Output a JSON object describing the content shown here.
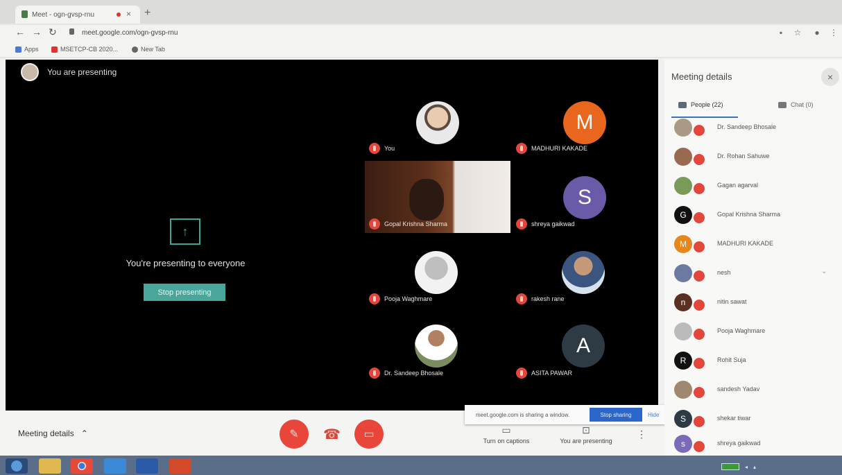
{
  "browser": {
    "tab_title": "Meet - ogn-gvsp-rnu",
    "url": "meet.google.com/ogn-gvsp-rnu",
    "bookmarks": [
      {
        "label": "Apps",
        "icon": "apps-icon"
      },
      {
        "label": "MSETCP-CB 2020...",
        "icon": "bookmark-icon"
      },
      {
        "label": "New Tab",
        "icon": "globe-icon"
      }
    ]
  },
  "meet": {
    "presenting_label": "You are presenting",
    "presenting_message": "You're presenting to everyone",
    "stop_presenting_label": "Stop presenting",
    "tiles": [
      {
        "name": "You",
        "avatar_letter": "",
        "avatar_color": "#d8d8d8",
        "style": "photo"
      },
      {
        "name": "MADHURI KAKADE",
        "avatar_letter": "M",
        "avatar_color": "#e8661e",
        "style": "letter"
      },
      {
        "name": "Gopal Krishna Sharma",
        "avatar_letter": "",
        "avatar_color": "#000000",
        "style": "video"
      },
      {
        "name": "shreya gaikwad",
        "avatar_letter": "S",
        "avatar_color": "#6a5aa8",
        "style": "letter"
      },
      {
        "name": "Pooja Waghmare",
        "avatar_letter": "",
        "avatar_color": "#cccccc",
        "style": "photo2"
      },
      {
        "name": "rakesh rane",
        "avatar_letter": "",
        "avatar_color": "#cccccc",
        "style": "photo3"
      },
      {
        "name": "Dr. Sandeep Bhosale",
        "avatar_letter": "",
        "avatar_color": "#cccccc",
        "style": "photo4"
      },
      {
        "name": "ASITA PAWAR",
        "avatar_letter": "A",
        "avatar_color": "#2e3a44",
        "style": "letter"
      }
    ],
    "bottom_bar": {
      "meeting_details_label": "Meeting details",
      "captions_label": "Turn on captions",
      "presenting_label": "You are presenting"
    },
    "toast": {
      "message": "meet.google.com is sharing a window.",
      "stop_label": "Stop sharing",
      "hide_label": "Hide"
    }
  },
  "panel": {
    "title": "Meeting details",
    "tab_people": "People (22)",
    "tab_chat": "Chat (0)",
    "people": [
      {
        "name": "Dr. Sandeep Bhosale",
        "avatar": "",
        "color": "#a89a86"
      },
      {
        "name": "Dr. Rohan Sahuwe",
        "avatar": "",
        "color": "#9a6a50"
      },
      {
        "name": "Gagan agarval",
        "avatar": "",
        "color": "#7a9a5a"
      },
      {
        "name": "Gopal Krishna Sharma",
        "avatar": "G",
        "color": "#111111"
      },
      {
        "name": "MADHURI KAKADE",
        "avatar": "M",
        "color": "#e8861e"
      },
      {
        "name": "nesh",
        "avatar": "",
        "color": "#6a7aa0"
      },
      {
        "name": "nitin sawat",
        "avatar": "n",
        "color": "#5a3020"
      },
      {
        "name": "Pooja Waghmare",
        "avatar": "",
        "color": "#bbbbbb"
      },
      {
        "name": "Rohit Suja",
        "avatar": "R",
        "color": "#111111"
      },
      {
        "name": "sandesh Yadav",
        "avatar": "",
        "color": "#a08870"
      },
      {
        "name": "shekar tiwar",
        "avatar": "S",
        "color": "#2e3a44"
      },
      {
        "name": "shreya gaikwad",
        "avatar": "s",
        "color": "#7a6ab8"
      }
    ]
  },
  "taskbar": {
    "apps": [
      "start",
      "explorer",
      "chrome",
      "edge",
      "word",
      "powerpoint"
    ]
  }
}
